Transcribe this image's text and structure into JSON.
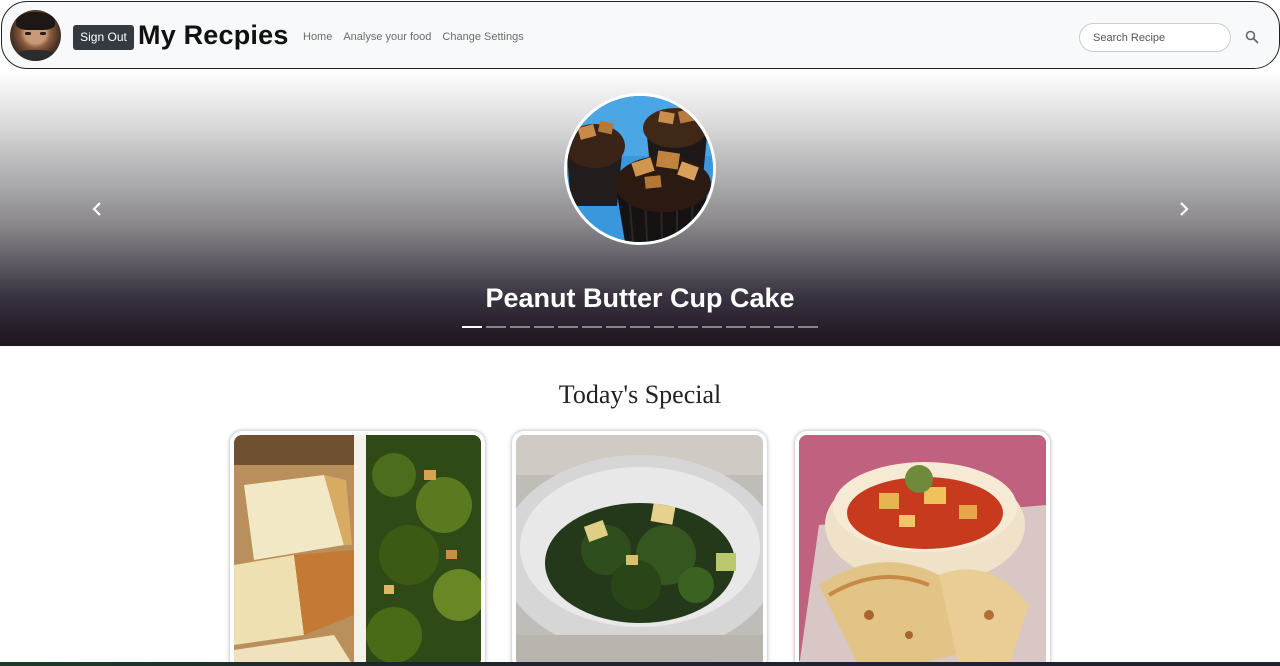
{
  "navbar": {
    "signout_label": "Sign Out",
    "brand": "My Recpies",
    "links": [
      "Home",
      "Analyse your food",
      "Change Settings"
    ],
    "search_placeholder": "Search Recipe"
  },
  "carousel": {
    "title": "Peanut Butter Cup Cake",
    "slide_count": 15,
    "active_index": 0
  },
  "special": {
    "title": "Today's Special",
    "cards": [
      {
        "image": "paneer-and-spinach-split-photo"
      },
      {
        "image": "spinach-paneer-bowl-photo"
      },
      {
        "image": "paneer-curry-with-naan-photo"
      }
    ]
  },
  "colors": {
    "signout_bg": "#343a40",
    "navbar_bg": "#f8f9fa"
  }
}
